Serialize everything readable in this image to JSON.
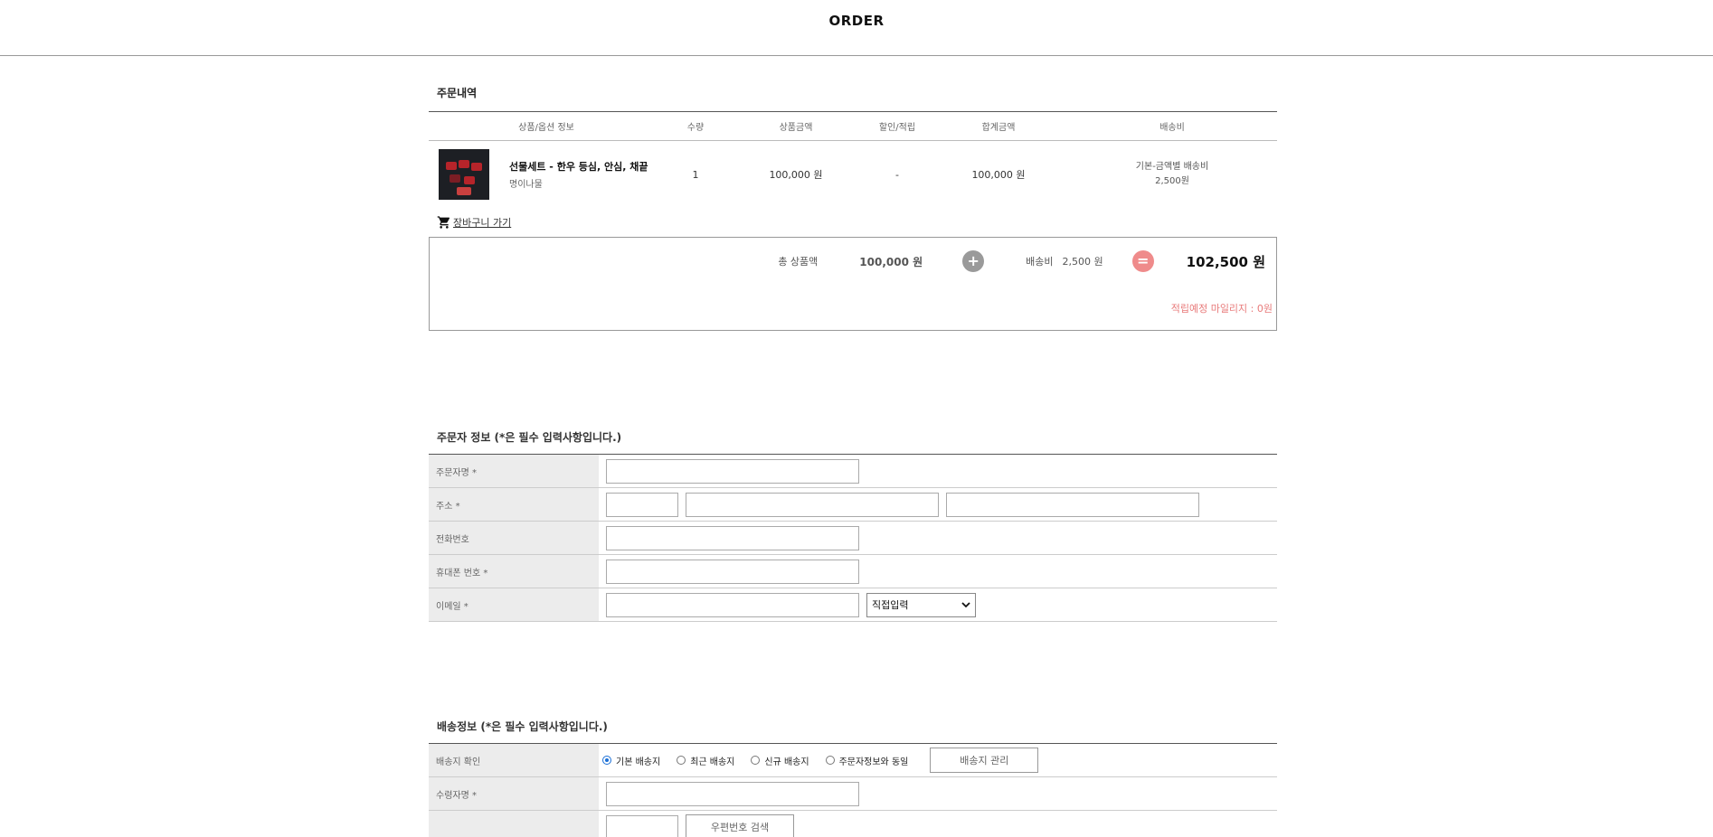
{
  "header": {
    "title": "ORDER"
  },
  "order": {
    "section_title": "주문내역",
    "columns": [
      "상품/옵션 정보",
      "수량",
      "상품금액",
      "할인/적립",
      "합계금액",
      "배송비"
    ],
    "item": {
      "name": "선물세트 - 한우 등심, 안심, 채끝",
      "option": "명이나물",
      "qty": "1",
      "price": "100,000 원",
      "discount": "-",
      "sum": "100,000 원",
      "ship_line1": "기본-금액별 배송비",
      "ship_line2": "2,500원"
    },
    "cart_link": "장바구니 가기",
    "totals": {
      "product_label": "총 상품액",
      "product_value": "100,000 원",
      "plus": "+",
      "ship_label": "배송비",
      "ship_value": "2,500 원",
      "equals": "=",
      "grand_total": "102,500 원",
      "mileage": "적립예정 마일리지 : 0원"
    }
  },
  "orderer": {
    "section_title": "주문자 정보 (*은 필수 입력사항입니다.)",
    "fields": {
      "name": "주문자명 *",
      "address": "주소 *",
      "phone": "전화번호",
      "mobile": "휴대폰 번호 *",
      "email": "이메일 *"
    },
    "email_select": "직접입력"
  },
  "shipping": {
    "section_title": "배송정보 (*은 필수 입력사항입니다.)",
    "fields": {
      "check": "배송지 확인",
      "receiver": "수령자명 *"
    },
    "radios": [
      "기본 배송지",
      "최근 배송지",
      "신규 배송지",
      "주문자정보와 동일"
    ],
    "selected_radio": "기본 배송지",
    "manage_button": "배송지 관리",
    "zip_search_button": "우편번호 검색"
  }
}
